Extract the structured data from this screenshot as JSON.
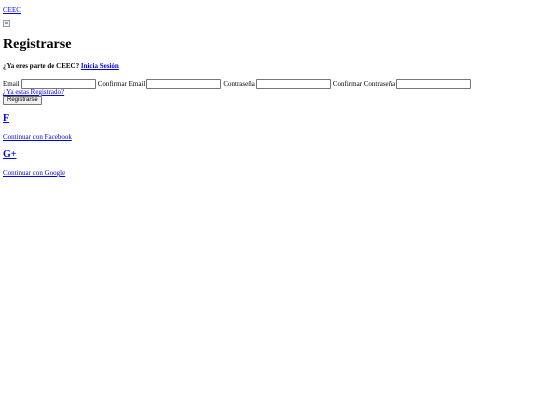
{
  "nav": {
    "brand": "CEEC"
  },
  "page": {
    "title": "Registrarse",
    "already_text": "¿Ya eres parte de CEEC?",
    "login_link": "Inicia Sesión"
  },
  "form": {
    "email_label": "Email",
    "confirm_email_label": "Confirmar Email",
    "password_label": "Contraseña",
    "confirm_password_label": "Confirmar Contraseña",
    "registered_link": "¿Ya estas Registrado?",
    "submit_label": "Registrarse"
  },
  "social": {
    "facebook_icon": "F",
    "facebook_label": "Continuar con Facebook",
    "google_icon": "G+",
    "google_label": "Continuar con Google"
  }
}
